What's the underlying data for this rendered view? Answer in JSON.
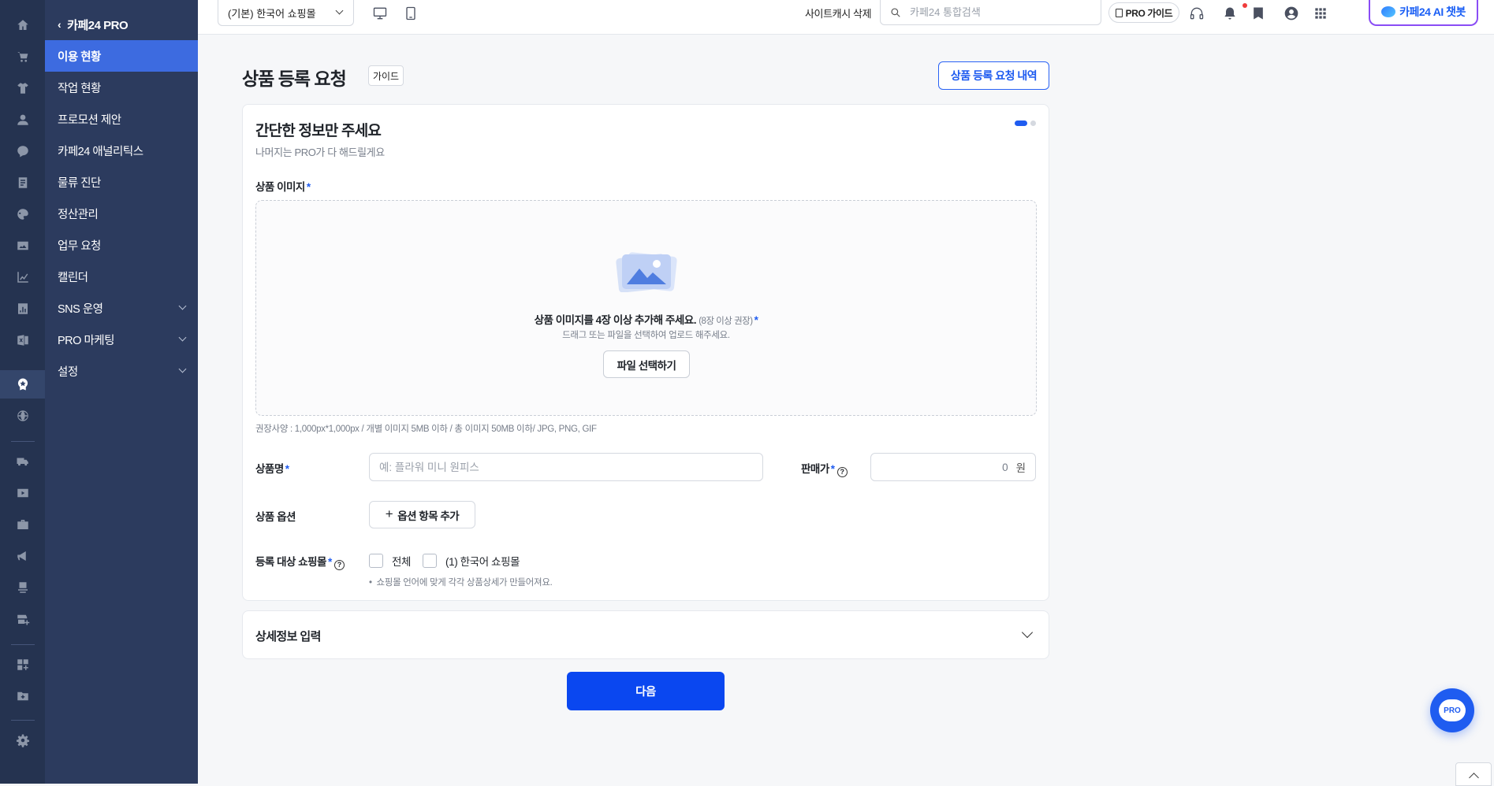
{
  "sidebar": {
    "back_label": "카페24 PRO",
    "items": [
      {
        "label": "이용 현황",
        "active": true,
        "has_children": false
      },
      {
        "label": "작업 현황",
        "active": false,
        "has_children": false
      },
      {
        "label": "프로모션 제안",
        "active": false,
        "has_children": false
      },
      {
        "label": "카페24 애널리틱스",
        "active": false,
        "has_children": false
      },
      {
        "label": "물류 진단",
        "active": false,
        "has_children": false
      },
      {
        "label": "정산관리",
        "active": false,
        "has_children": false
      },
      {
        "label": "업무 요청",
        "active": false,
        "has_children": false
      },
      {
        "label": "캘린더",
        "active": false,
        "has_children": false
      },
      {
        "label": "SNS 운영",
        "active": false,
        "has_children": true
      },
      {
        "label": "PRO 마케팅",
        "active": false,
        "has_children": true
      },
      {
        "label": "설정",
        "active": false,
        "has_children": true
      }
    ]
  },
  "rail": {
    "icons": [
      "home-icon",
      "cart-icon",
      "shirt-icon",
      "user-icon",
      "chat-icon",
      "board-icon",
      "palette-icon",
      "image-icon",
      "chart-icon",
      "stats-icon",
      "excel-icon",
      "pro-badge-icon",
      "globe-icon",
      "truck-icon",
      "video-icon",
      "briefcase-icon",
      "megaphone-icon",
      "store-icon",
      "add-store-icon",
      "apps-icon",
      "folder-icon",
      "settings-icon"
    ],
    "active": "pro-badge-icon"
  },
  "topbar": {
    "mall_select": "(기본) 한국어 쇼핑몰",
    "cache_button": "사이트캐시 삭제",
    "search_placeholder": "카페24 통합검색",
    "pro_guide": "PRO 가이드",
    "ai_button": "카페24 AI 챗봇"
  },
  "page": {
    "title": "상품 등록 요청",
    "guide_tag": "가이드",
    "history_button": "상품 등록 요청 내역"
  },
  "form": {
    "heading": "간단한 정보만 주세요",
    "subheading": "나머지는 PRO가 다 해드릴게요",
    "image_label": "상품 이미지",
    "required_mark": "*",
    "dropzone_main": "상품 이미지를 4장 이상 추가해 주세요.",
    "dropzone_recommend": "(8장 이상 권장)",
    "dropzone_sub": "드래그 또는 파일을 선택하여 업로드 해주세요.",
    "file_button": "파일 선택하기",
    "spec": "권장사양 : 1,000px*1,000px / 개별 이미지 5MB 이하 / 총 이미지 50MB 이하/ JPG, PNG, GIF",
    "name_label": "상품명",
    "name_placeholder": "예: 플라워 미니 원피스",
    "price_label": "판매가",
    "price_value": "0",
    "price_unit": "원",
    "option_label": "상품 옵션",
    "option_button": "옵션 항목 추가",
    "mall_label": "등록 대상 쇼핑몰",
    "mall_options": [
      "전체",
      "(1) 한국어 쇼핑몰"
    ],
    "mall_note": "쇼핑몰 언어에 맞게 각각 상품상세가 만들어져요.",
    "step_current": 1,
    "step_total": 2
  },
  "detail": {
    "title": "상세정보 입력"
  },
  "actions": {
    "next": "다음",
    "chat_fab": "PRO"
  },
  "colors": {
    "accent": "#1f5cf0",
    "sidebar": "#2c3b5e",
    "rail": "#253350",
    "active_menu": "#3d6be0"
  }
}
